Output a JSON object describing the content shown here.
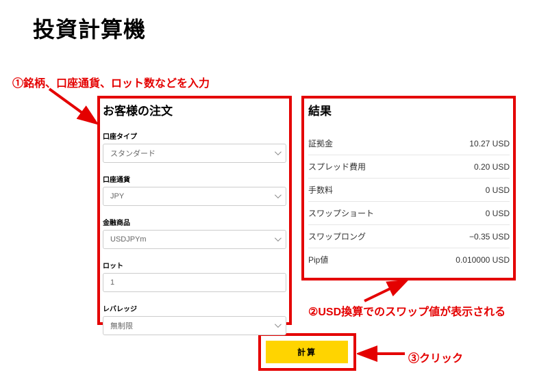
{
  "title": "投資計算機",
  "annotations": {
    "a1": "①銘柄、口座通貨、ロット数などを入力",
    "a2": "②USD換算でのスワップ値が表示される",
    "a3": "③クリック"
  },
  "form": {
    "heading": "お客様の注文",
    "fields": {
      "account_type": {
        "label": "口座タイプ",
        "value": "スタンダード"
      },
      "account_currency": {
        "label": "口座通貨",
        "value": "JPY"
      },
      "instrument": {
        "label": "金融商品",
        "value": "USDJPYm"
      },
      "lot": {
        "label": "ロット",
        "value": "1"
      },
      "leverage": {
        "label": "レバレッジ",
        "value": "無制限"
      }
    }
  },
  "results": {
    "heading": "結果",
    "rows": [
      {
        "label": "証拠金",
        "value": "10.27 USD"
      },
      {
        "label": "スプレッド費用",
        "value": "0.20 USD"
      },
      {
        "label": "手数料",
        "value": "0 USD"
      },
      {
        "label": "スワップショート",
        "value": "0 USD"
      },
      {
        "label": "スワップロング",
        "value": "−0.35 USD"
      },
      {
        "label": "Pip値",
        "value": "0.010000 USD"
      }
    ]
  },
  "button": {
    "calculate": "計算"
  }
}
